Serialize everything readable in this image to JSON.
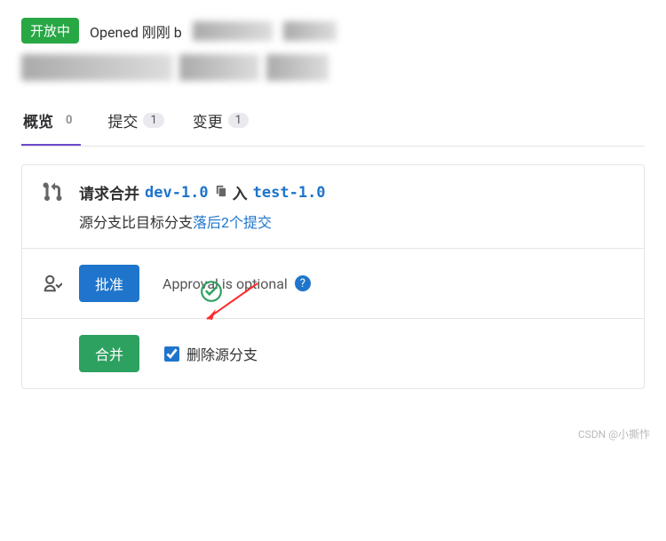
{
  "status_badge": "开放中",
  "opened_text": "Opened 刚刚 b",
  "tabs": {
    "overview": {
      "label": "概览",
      "count": "0"
    },
    "commits": {
      "label": "提交",
      "count": "1"
    },
    "changes": {
      "label": "变更",
      "count": "1"
    }
  },
  "merge_request": {
    "title_prefix": "请求合并",
    "source_branch": "dev-1.0",
    "into": "入",
    "target_branch": "test-1.0",
    "sub_prefix": "源分支比目标分支",
    "sub_link": "落后2个提交"
  },
  "approval": {
    "button": "批准",
    "optional_text": "Approval is optional"
  },
  "merge": {
    "button": "合并",
    "delete_source": "删除源分支"
  },
  "watermark": "CSDN @小撕怍"
}
